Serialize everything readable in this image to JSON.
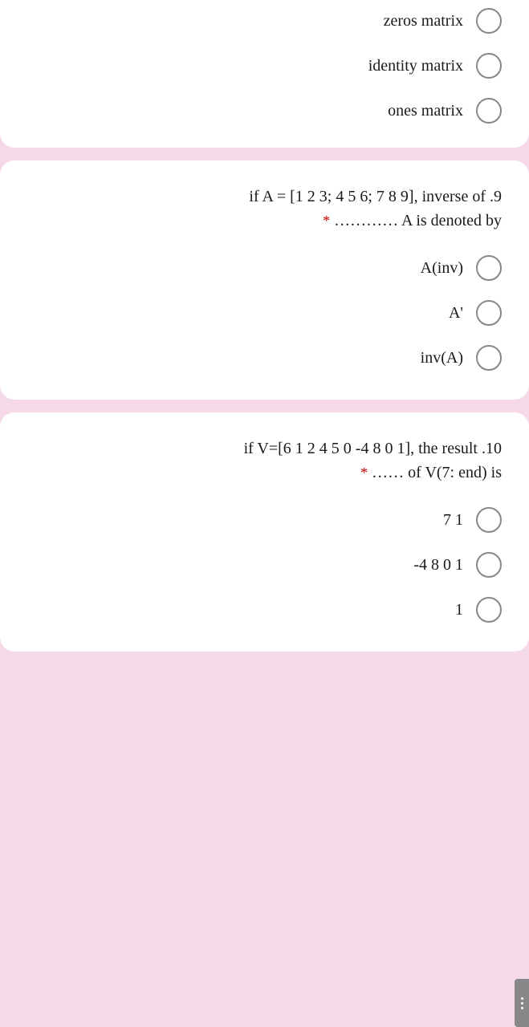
{
  "cards": [
    {
      "id": "card-top-partial",
      "options": [
        {
          "label": "zeros matrix",
          "value": "zeros_matrix"
        },
        {
          "label": "identity matrix",
          "value": "identity_matrix"
        },
        {
          "label": "ones matrix",
          "value": "ones_matrix"
        }
      ]
    },
    {
      "id": "card-question-2",
      "question_line1": "if A = [1 2 3; 4 5 6; 7 8 9], inverse of .9",
      "question_asterisk": "*",
      "question_line2": "………… A is denoted by",
      "options": [
        {
          "label": "A(inv)",
          "value": "a_inv"
        },
        {
          "label": "A'",
          "value": "a_prime"
        },
        {
          "label": "inv(A)",
          "value": "inv_a"
        }
      ]
    },
    {
      "id": "card-question-3",
      "question_line1": "if V=[6 1 2 4 5 0 -4 8 0 1], the result .10",
      "question_asterisk": "*",
      "question_line2": "…… of V(7: end) is",
      "options": [
        {
          "label": "7 1",
          "value": "7_1"
        },
        {
          "label": "-4 8 0 1",
          "value": "-4801"
        },
        {
          "label": "1",
          "value": "one"
        }
      ]
    }
  ]
}
